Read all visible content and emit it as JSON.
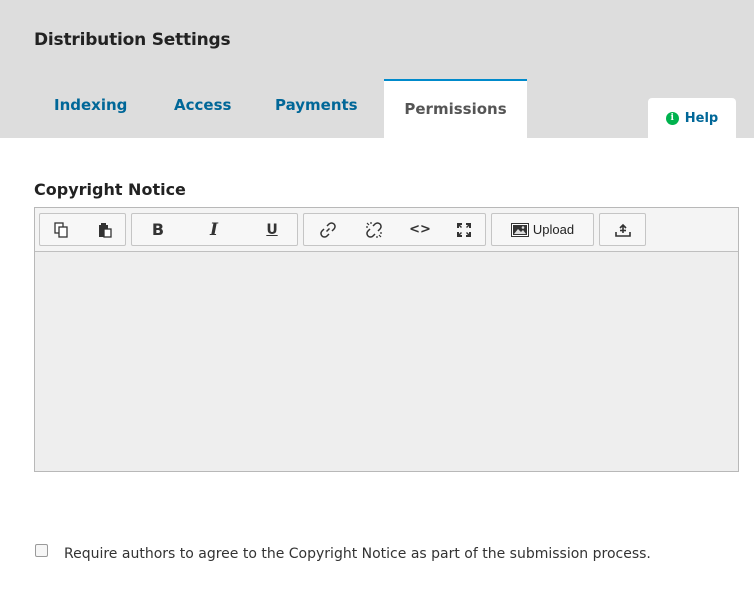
{
  "header": {
    "title": "Distribution Settings",
    "tabs": [
      {
        "label": "Indexing"
      },
      {
        "label": "Access"
      },
      {
        "label": "Payments"
      },
      {
        "label": "Permissions"
      }
    ],
    "help_label": "Help",
    "help_icon": "info-icon"
  },
  "form": {
    "copyright_label": "Copyright Notice",
    "editor": {
      "toolbar": {
        "copy": "copy-icon",
        "paste": "paste-icon",
        "bold": "bold-icon",
        "italic": "italic-icon",
        "underline": "underline-icon",
        "link": "link-icon",
        "unlink": "unlink-icon",
        "code": "code-icon",
        "fullscreen": "fullscreen-icon",
        "upload_label": "Upload",
        "upload_icon": "image-icon",
        "insert": "insert-icon"
      },
      "content": ""
    },
    "require_agree_label": "Require authors to agree to the Copyright Notice as part of the submission process.",
    "require_agree_checked": false
  },
  "colors": {
    "header_bg": "#dddddd",
    "tab_link": "#006798",
    "active_tab_border": "#008acb",
    "help_icon_bg": "#00b24e"
  }
}
